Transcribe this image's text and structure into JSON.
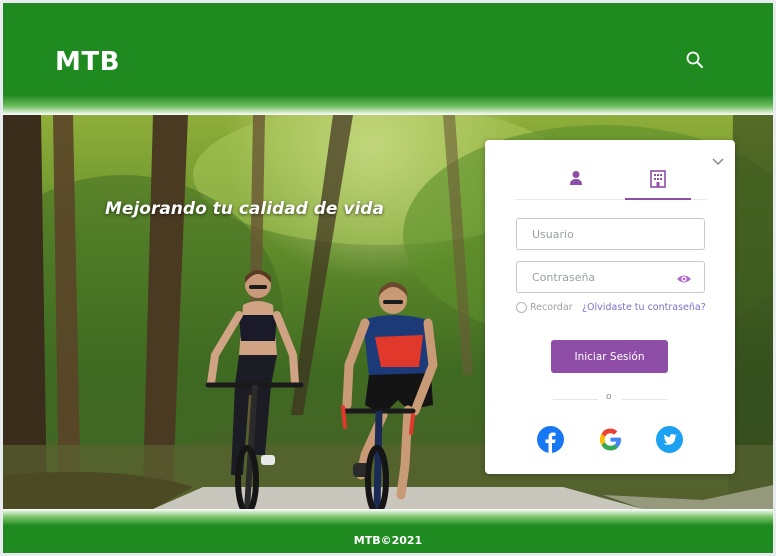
{
  "header": {
    "logo": "MTB",
    "search_icon": "search-icon"
  },
  "hero": {
    "tagline": "Mejorando tu calidad de vida"
  },
  "login": {
    "collapse_icon": "chevron-down-icon",
    "tabs": [
      {
        "icon": "user-icon",
        "active": false
      },
      {
        "icon": "building-icon",
        "active": true
      }
    ],
    "username_placeholder": "Usuario",
    "password_placeholder": "Contraseña",
    "password_toggle_icon": "eye-icon",
    "remember_label": "Recordar",
    "forgot_link": "¿Olvidaste tu contraseña?",
    "submit_label": "Iniciar Sesión",
    "separator": "o",
    "social": [
      "facebook-icon",
      "google-icon",
      "twitter-icon"
    ]
  },
  "footer": {
    "copyright": "MTB©2021"
  },
  "colors": {
    "primary_green": "#1f8a1f",
    "accent_purple": "#8e4ea8",
    "link_purple": "#7b6fc9",
    "facebook": "#1877f2",
    "twitter": "#1da1f2"
  }
}
